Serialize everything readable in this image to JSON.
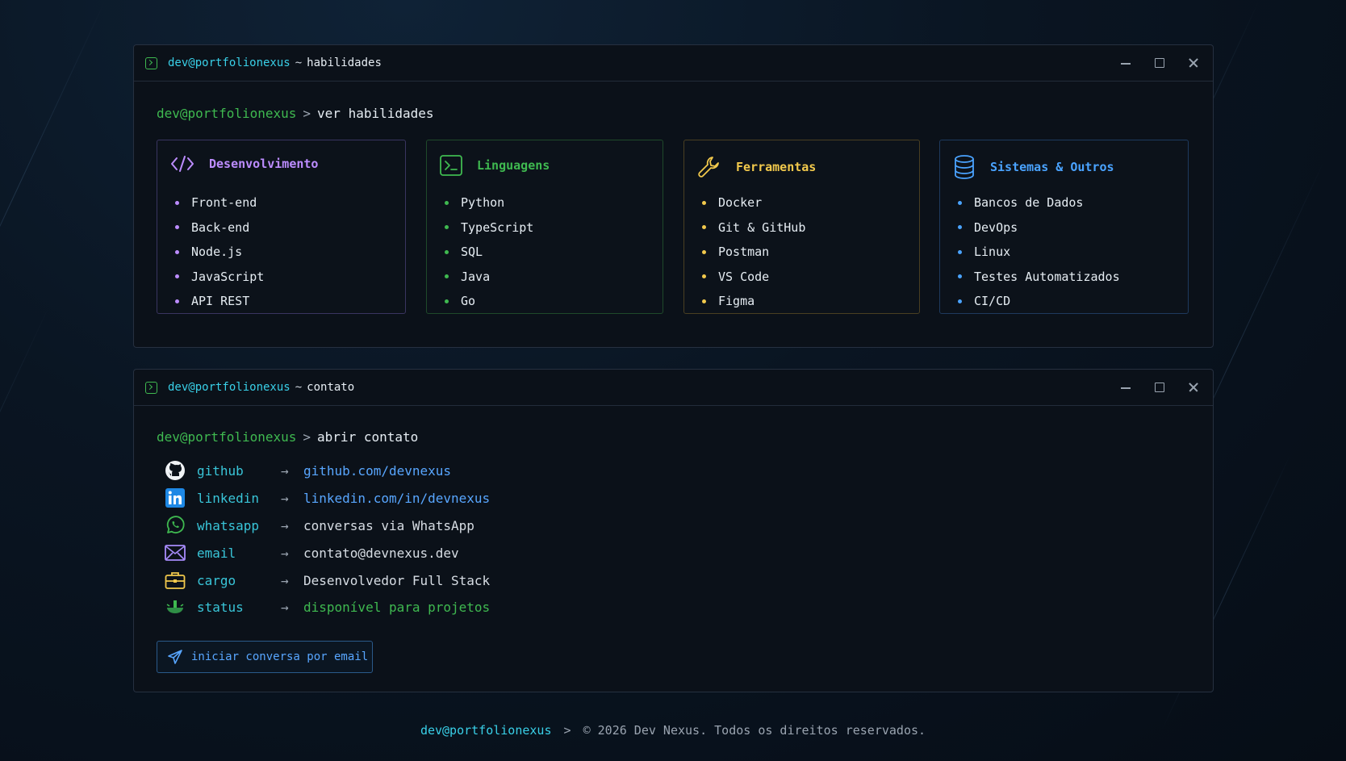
{
  "colors": {
    "green": "#3fb950",
    "cyan": "#39d0e8",
    "purple": "#bc8cff",
    "yellow": "#f2c94c",
    "blue": "#4aa3ff"
  },
  "skills_window": {
    "title_user": "dev@portfolionexus",
    "title_sep": "~",
    "title_path": "habilidades",
    "prompt_user": "dev@portfolionexus",
    "prompt_arrow": ">",
    "prompt_cmd": "ver habilidades",
    "cards": [
      {
        "title": "Desenvolvimento",
        "icon": "code-icon",
        "items": [
          "Front-end",
          "Back-end",
          "Node.js",
          "JavaScript",
          "API REST"
        ]
      },
      {
        "title": "Linguagens",
        "icon": "terminal-icon",
        "items": [
          "Python",
          "TypeScript",
          "SQL",
          "Java",
          "Go"
        ]
      },
      {
        "title": "Ferramentas",
        "icon": "wrench-icon",
        "items": [
          "Docker",
          "Git & GitHub",
          "Postman",
          "VS Code",
          "Figma"
        ]
      },
      {
        "title": "Sistemas & Outros",
        "icon": "database-icon",
        "items": [
          "Bancos de Dados",
          "DevOps",
          "Linux",
          "Testes Automatizados",
          "CI/CD"
        ]
      }
    ]
  },
  "contact_window": {
    "title_user": "dev@portfolionexus",
    "title_sep": "~",
    "title_path": "contato",
    "prompt_user": "dev@portfolionexus",
    "prompt_arrow": ">",
    "prompt_cmd": "abrir contato",
    "rows": [
      {
        "key": "github",
        "arrow": "→",
        "value": "github.com/devnexus",
        "icon": "github-icon"
      },
      {
        "key": "linkedin",
        "arrow": "→",
        "value": "linkedin.com/in/devnexus",
        "icon": "linkedin-icon"
      },
      {
        "key": "whatsapp",
        "arrow": "→",
        "value": "conversas via WhatsApp",
        "icon": "whatsapp-icon"
      },
      {
        "key": "email",
        "arrow": "→",
        "value": "contato@devnexus.dev",
        "icon": "mail-icon"
      },
      {
        "key": "cargo",
        "arrow": "→",
        "value": "Desenvolvedor Full Stack",
        "icon": "briefcase-icon"
      },
      {
        "key": "status",
        "arrow": "→",
        "value": "disponível para projetos",
        "icon": "status-icon"
      }
    ],
    "button_label": "iniciar conversa por email"
  },
  "footer": {
    "user": "dev@portfolionexus",
    "arrow": ">",
    "text": "© 2026 Dev Nexus. Todos os direitos reservados."
  }
}
